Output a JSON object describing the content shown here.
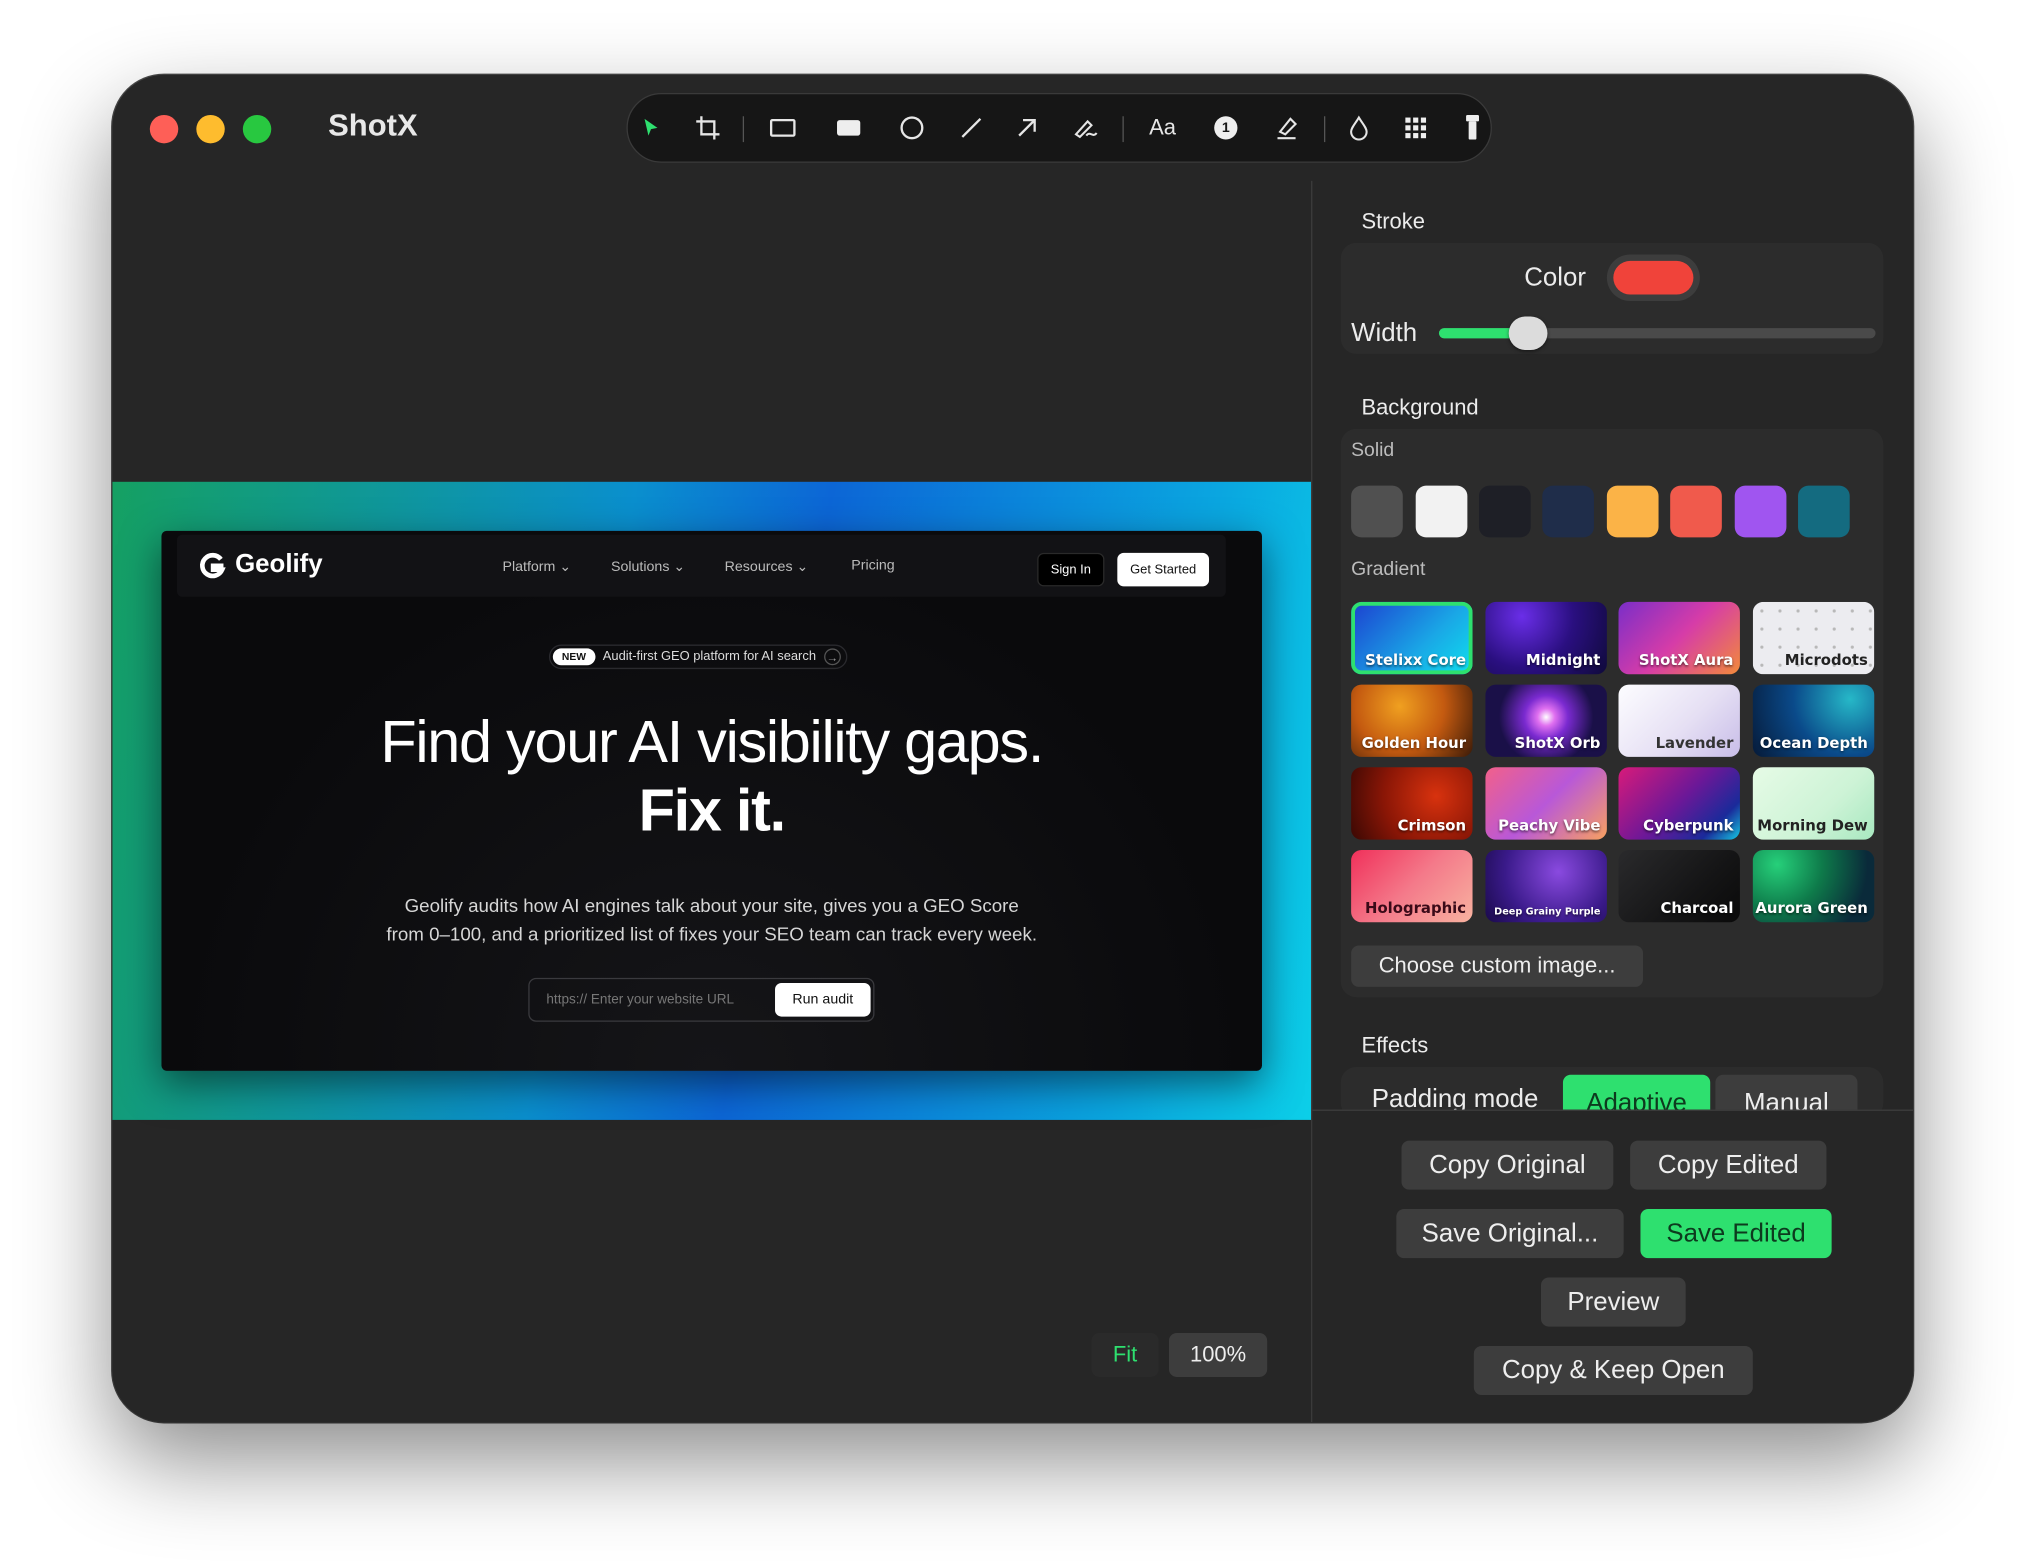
{
  "app": {
    "title": "ShotX"
  },
  "toolbar": {
    "tools": [
      "select-icon",
      "crop-icon",
      "rectangle-icon",
      "filled-rectangle-icon",
      "ellipse-icon",
      "line-icon",
      "arrow-icon",
      "freehand-icon",
      "text-tool",
      "counter-icon",
      "highlighter-icon",
      "blur-icon",
      "pixelate-icon",
      "flashlight-icon"
    ],
    "text_label": "Aa",
    "counter_label": "1",
    "active_color": "#2ee06f"
  },
  "canvas_shot": {
    "brand": "Geolify",
    "nav": [
      "Platform",
      "Solutions",
      "Resources",
      "Pricing"
    ],
    "signin": "Sign In",
    "get_started": "Get Started",
    "badge": "NEW",
    "badge_text": "Audit-first GEO platform for AI search",
    "headline1": "Find your AI visibility gaps.",
    "headline2": "Fix it.",
    "para1": "Geolify audits how AI engines talk about your site, gives you a GEO Score",
    "para2": "from 0–100, and a prioritized list of fixes your SEO team can track every week.",
    "url_placeholder": "https:// Enter your website URL",
    "run_audit": "Run audit"
  },
  "zoom": {
    "fit": "Fit",
    "percent": "100%"
  },
  "panel": {
    "stroke": {
      "title": "Stroke",
      "color_label": "Color",
      "color": "#f0433a",
      "width_label": "Width",
      "width_fraction": 0.2
    },
    "background": {
      "title": "Background",
      "solid_label": "Solid",
      "gradient_label": "Gradient",
      "solids": [
        "#505050",
        "#f2f2f2",
        "#1e1f26",
        "#1f2d4a",
        "#fbb347",
        "#f05a4c",
        "#a055f0",
        "#146b80"
      ],
      "gradients": [
        "Stelixx Core",
        "Midnight",
        "ShotX Aura",
        "Microdots",
        "Golden Hour",
        "ShotX Orb",
        "Lavender",
        "Ocean Depth",
        "Crimson",
        "Peachy Vibe",
        "Cyberpunk",
        "Morning Dew",
        "Holographic",
        "Deep Grainy Purple",
        "Charcoal",
        "Aurora Green"
      ],
      "custom_label": "Choose custom image..."
    },
    "effects": {
      "title": "Effects",
      "padding_label": "Padding mode",
      "adaptive": "Adaptive",
      "manual": "Manual"
    }
  },
  "actions": {
    "copy_original": "Copy Original",
    "copy_edited": "Copy Edited",
    "save_original": "Save Original...",
    "save_edited": "Save Edited",
    "preview": "Preview",
    "copy_keep": "Copy & Keep Open"
  }
}
